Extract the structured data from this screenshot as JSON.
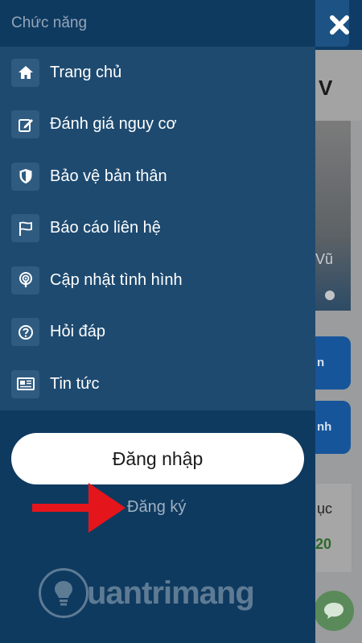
{
  "drawer": {
    "title": "Chức năng",
    "items": [
      {
        "label": "Trang chủ",
        "icon": "home-icon"
      },
      {
        "label": "Đánh giá nguy cơ",
        "icon": "edit-icon"
      },
      {
        "label": "Bảo vệ bản thân",
        "icon": "shield-icon"
      },
      {
        "label": "Báo cáo liên hệ",
        "icon": "flag-icon"
      },
      {
        "label": "Cập nhật tình hình",
        "icon": "broadcast-icon"
      },
      {
        "label": "Hỏi đáp",
        "icon": "question-icon"
      },
      {
        "label": "Tin tức",
        "icon": "newspaper-icon"
      }
    ],
    "login_label": "Đăng nhập",
    "register_label": "Đăng ký"
  },
  "background": {
    "heading_fragment": "V",
    "banner_fragment": "Vũ",
    "button1_fragment": "n",
    "button2_fragment": "nh",
    "card_fragment": "ục",
    "card_number_fragment": "20"
  },
  "watermark": {
    "text": "uantrimang"
  },
  "colors": {
    "drawer_bg": "#0f3a60",
    "menu_bg": "#1e4a70",
    "icon_bg": "#2f5b80",
    "arrow": "#e4161b"
  }
}
